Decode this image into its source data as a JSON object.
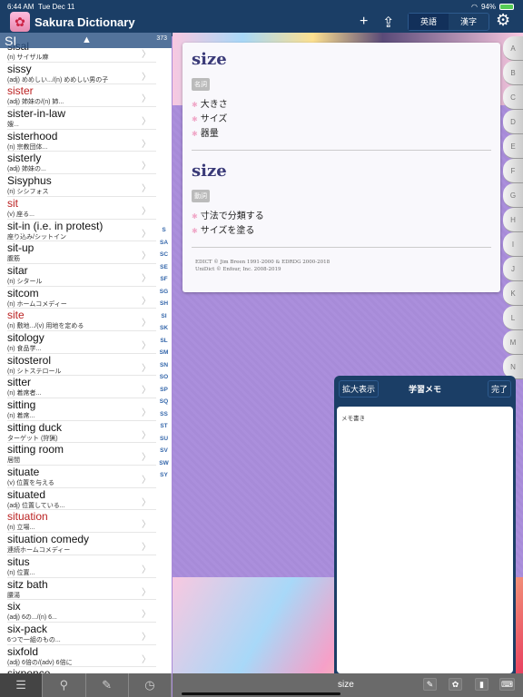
{
  "status": {
    "time": "6:44 AM",
    "date": "Tue Dec 11",
    "battery": "94%"
  },
  "app": {
    "title": "Sakura Dictionary",
    "logo": "✿"
  },
  "toolbar": {
    "add": "+",
    "share": "⇪",
    "seg": [
      "英語",
      "漢字"
    ],
    "seg_selected": 0,
    "settings": "⚙"
  },
  "list": {
    "section": "SI",
    "count": "373",
    "up": "▲",
    "items": [
      {
        "w": "sisal",
        "d": "(n) サイザル麻",
        "red": false
      },
      {
        "w": "sissy",
        "d": "(adj) めめしい.../(n) めめしい男の子",
        "red": false
      },
      {
        "w": "sister",
        "d": "(adj) 姉妹の/(n) 姉...",
        "red": true
      },
      {
        "w": "sister-in-law",
        "d": "嫂...",
        "red": false
      },
      {
        "w": "sisterhood",
        "d": "(n) 宗教団体...",
        "red": false
      },
      {
        "w": "sisterly",
        "d": "(adj) 姉妹の...",
        "red": false
      },
      {
        "w": "Sisyphus",
        "d": "(n) シシフォス",
        "red": false
      },
      {
        "w": "sit",
        "d": "(v) 座る...",
        "red": true
      },
      {
        "w": "sit-in (i.e. in protest)",
        "d": "座り込み/シットイン",
        "red": false
      },
      {
        "w": "sit-up",
        "d": "腹筋",
        "red": false
      },
      {
        "w": "sitar",
        "d": "(n) シタール",
        "red": false
      },
      {
        "w": "sitcom",
        "d": "(n) ホームコメディー",
        "red": false
      },
      {
        "w": "site",
        "d": "(n) 敷地.../(v) 用地を定める",
        "red": true
      },
      {
        "w": "sitology",
        "d": "(n) 食品学...",
        "red": false
      },
      {
        "w": "sitosterol",
        "d": "(n) シトステロール",
        "red": false
      },
      {
        "w": "sitter",
        "d": "(n) 着席者...",
        "red": false
      },
      {
        "w": "sitting",
        "d": "(n) 着席...",
        "red": false
      },
      {
        "w": "sitting duck",
        "d": "ターゲット (狩猟)",
        "red": false
      },
      {
        "w": "sitting room",
        "d": "居間",
        "red": false
      },
      {
        "w": "situate",
        "d": "(v) 位置を与える",
        "red": false
      },
      {
        "w": "situated",
        "d": "(adj) 位置している...",
        "red": false
      },
      {
        "w": "situation",
        "d": "(n) 立場...",
        "red": true
      },
      {
        "w": "situation comedy",
        "d": "連続ホームコメディー",
        "red": false
      },
      {
        "w": "situs",
        "d": "(n) 位置...",
        "red": false
      },
      {
        "w": "sitz bath",
        "d": "腰湯",
        "red": false
      },
      {
        "w": "six",
        "d": "(adj) 6の.../(n) 6...",
        "red": false
      },
      {
        "w": "six-pack",
        "d": "6つで一組のもの...",
        "red": false
      },
      {
        "w": "sixfold",
        "d": "(adj) 6倍の/(adv) 6倍に",
        "red": false
      },
      {
        "w": "sixpence",
        "d": "",
        "red": false
      }
    ],
    "index": [
      "S",
      "SA",
      "SC",
      "SE",
      "SF",
      "SG",
      "SH",
      "SI",
      "SK",
      "SL",
      "SM",
      "SN",
      "SO",
      "SP",
      "SQ",
      "SS",
      "ST",
      "SU",
      "SV",
      "SW",
      "SY"
    ]
  },
  "left_tools": [
    {
      "icon": "list-icon",
      "g": "☰"
    },
    {
      "icon": "search-icon",
      "g": "⚲"
    },
    {
      "icon": "marker-icon",
      "g": "✎"
    },
    {
      "icon": "history-icon",
      "g": "◷"
    }
  ],
  "entry": {
    "blocks": [
      {
        "hw": "size",
        "pos": "名詞",
        "senses": [
          "大きさ",
          "サイズ",
          "器量"
        ]
      },
      {
        "hw": "size",
        "pos": "動詞",
        "senses": [
          "寸法で分類する",
          "サイズを塗る"
        ]
      }
    ],
    "credits": [
      "EDICT © Jim Breen 1991-2000 & EDRDG 2000-2018",
      "UniDict © Enfour, Inc. 2008-2019"
    ]
  },
  "alpha_tabs": [
    "A",
    "B",
    "C",
    "D",
    "E",
    "F",
    "G",
    "H",
    "I",
    "J",
    "K",
    "L",
    "M",
    "N"
  ],
  "memo": {
    "expand": "拡大表示",
    "title": "学習メモ",
    "done": "完了",
    "placeholder": "メモ書き"
  },
  "bottom": {
    "word": "size"
  }
}
